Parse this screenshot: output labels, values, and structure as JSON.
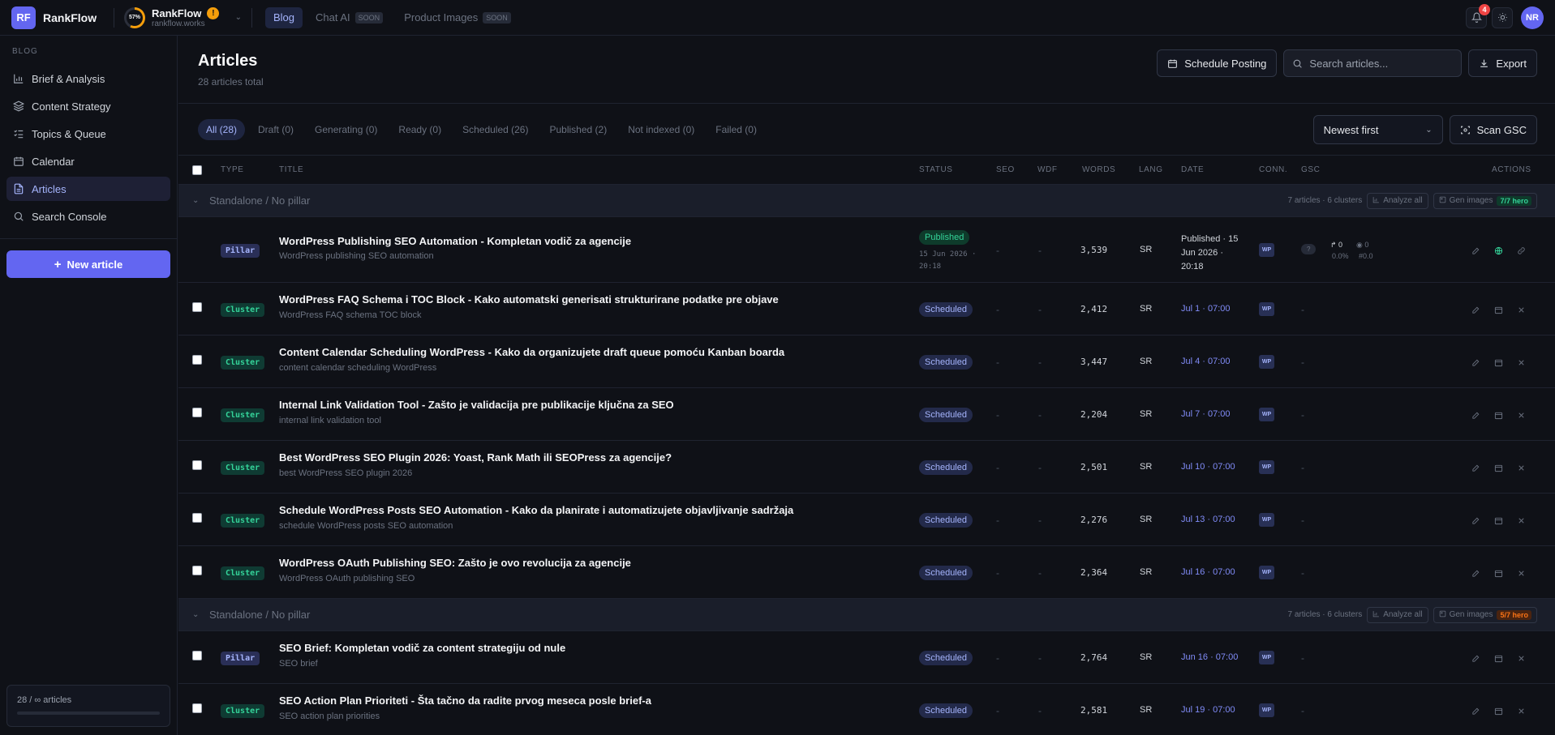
{
  "app": {
    "logo_mark": "RF",
    "name": "RankFlow"
  },
  "project": {
    "name": "RankFlow",
    "url": "rankflow.works",
    "score": "57%",
    "warn": "!"
  },
  "nav": [
    {
      "label": "Blog",
      "badge": ""
    },
    {
      "label": "Chat AI",
      "badge": "SOON"
    },
    {
      "label": "Product Images",
      "badge": "SOON"
    }
  ],
  "topbar": {
    "notifications": "4",
    "avatar": "NR"
  },
  "sidebar": {
    "section": "BLOG",
    "items": [
      {
        "label": "Brief & Analysis",
        "icon": "chart-icon"
      },
      {
        "label": "Content Strategy",
        "icon": "layers-icon"
      },
      {
        "label": "Topics & Queue",
        "icon": "list-check-icon"
      },
      {
        "label": "Calendar",
        "icon": "calendar-icon"
      },
      {
        "label": "Articles",
        "icon": "document-icon"
      },
      {
        "label": "Search Console",
        "icon": "search-icon"
      }
    ],
    "new_article": "New article",
    "usage": "28 / ∞ articles"
  },
  "header": {
    "title": "Articles",
    "subtitle": "28 articles total",
    "schedule_button": "Schedule Posting",
    "search_placeholder": "Search articles...",
    "export_button": "Export"
  },
  "filters": {
    "tabs": [
      "All (28)",
      "Draft (0)",
      "Generating (0)",
      "Ready (0)",
      "Scheduled (26)",
      "Published (2)",
      "Not indexed (0)",
      "Failed (0)"
    ],
    "sort": "Newest first",
    "scan_button": "Scan GSC"
  },
  "table": {
    "columns": {
      "type": "TYPE",
      "title": "TITLE",
      "status": "STATUS",
      "seo": "SEO",
      "wdf": "WDF",
      "words": "WORDS",
      "lang": "LANG",
      "date": "DATE",
      "conn": "CONN.",
      "gsc": "GSC",
      "actions": "ACTIONS"
    },
    "groups": [
      {
        "title": "Standalone / No pillar",
        "meta": "7 articles · 6 clusters",
        "analyze": "Analyze all",
        "gen": "Gen images",
        "hero": "7/7 hero",
        "hero_color": "#34d399",
        "rows": [
          {
            "type": "Pillar",
            "title": "WordPress Publishing SEO Automation - Kompletan vodič za agencije",
            "keyword": "WordPress publishing SEO automation",
            "status": "Published",
            "status_sub": "15 Jun 2026 · 20:18",
            "seo": "-",
            "wdf": "-",
            "words": "3,539",
            "lang": "SR",
            "date": "Published · 15 Jun 2026 · 20:18",
            "conn": "WP",
            "gsc": {
              "badge": "?",
              "clicks": "0",
              "views": "0",
              "ctr": "0.0%",
              "pos": "#0.0"
            }
          },
          {
            "type": "Cluster",
            "title": "WordPress FAQ Schema i TOC Block - Kako automatski generisati strukturirane podatke pre objave",
            "keyword": "WordPress FAQ schema TOC block",
            "status": "Scheduled",
            "seo": "-",
            "wdf": "-",
            "words": "2,412",
            "lang": "SR",
            "date": "Jul 1 · 07:00",
            "conn": "WP",
            "gsc": "-"
          },
          {
            "type": "Cluster",
            "title": "Content Calendar Scheduling WordPress - Kako da organizujete draft queue pomoću Kanban boarda",
            "keyword": "content calendar scheduling WordPress",
            "status": "Scheduled",
            "seo": "-",
            "wdf": "-",
            "words": "3,447",
            "lang": "SR",
            "date": "Jul 4 · 07:00",
            "conn": "WP",
            "gsc": "-"
          },
          {
            "type": "Cluster",
            "title": "Internal Link Validation Tool - Zašto je validacija pre publikacije ključna za SEO",
            "keyword": "internal link validation tool",
            "status": "Scheduled",
            "seo": "-",
            "wdf": "-",
            "words": "2,204",
            "lang": "SR",
            "date": "Jul 7 · 07:00",
            "conn": "WP",
            "gsc": "-"
          },
          {
            "type": "Cluster",
            "title": "Best WordPress SEO Plugin 2026: Yoast, Rank Math ili SEOPress za agencije?",
            "keyword": "best WordPress SEO plugin 2026",
            "status": "Scheduled",
            "seo": "-",
            "wdf": "-",
            "words": "2,501",
            "lang": "SR",
            "date": "Jul 10 · 07:00",
            "conn": "WP",
            "gsc": "-"
          },
          {
            "type": "Cluster",
            "title": "Schedule WordPress Posts SEO Automation - Kako da planirate i automatizujete objavljivanje sadržaja",
            "keyword": "schedule WordPress posts SEO automation",
            "status": "Scheduled",
            "seo": "-",
            "wdf": "-",
            "words": "2,276",
            "lang": "SR",
            "date": "Jul 13 · 07:00",
            "conn": "WP",
            "gsc": "-"
          },
          {
            "type": "Cluster",
            "title": "WordPress OAuth Publishing SEO: Zašto je ovo revolucija za agencije",
            "keyword": "WordPress OAuth publishing SEO",
            "status": "Scheduled",
            "seo": "-",
            "wdf": "-",
            "words": "2,364",
            "lang": "SR",
            "date": "Jul 16 · 07:00",
            "conn": "WP",
            "gsc": "-"
          }
        ]
      },
      {
        "title": "Standalone / No pillar",
        "meta": "7 articles · 6 clusters",
        "analyze": "Analyze all",
        "gen": "Gen images",
        "hero": "5/7 hero",
        "hero_color": "#f97316",
        "rows": [
          {
            "type": "Pillar",
            "title": "SEO Brief: Kompletan vodič za content strategiju od nule",
            "keyword": "SEO brief",
            "status": "Scheduled",
            "seo": "-",
            "wdf": "-",
            "words": "2,764",
            "lang": "SR",
            "date": "Jun 16 · 07:00",
            "conn": "WP",
            "gsc": "-"
          },
          {
            "type": "Cluster",
            "title": "SEO Action Plan Prioriteti - Šta tačno da radite prvog meseca posle brief-a",
            "keyword": "SEO action plan priorities",
            "status": "Scheduled",
            "seo": "-",
            "wdf": "-",
            "words": "2,581",
            "lang": "SR",
            "date": "Jul 19 · 07:00",
            "conn": "WP",
            "gsc": "-"
          }
        ]
      }
    ]
  },
  "colors": {
    "accent": "#6366f1",
    "background": "#0f1117",
    "published": "#34d399",
    "scheduled": "#a5b4fc"
  }
}
